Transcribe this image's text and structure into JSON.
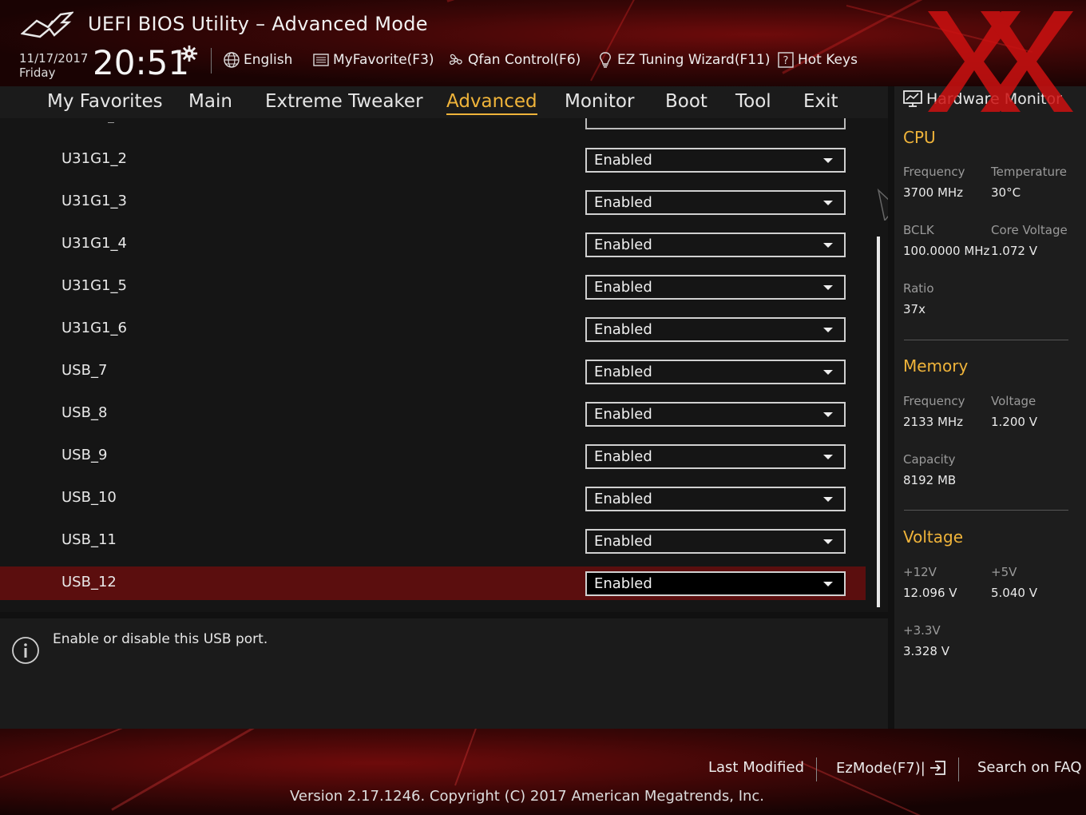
{
  "header": {
    "title": "UEFI BIOS Utility – Advanced Mode",
    "date": "11/17/2017",
    "day": "Friday",
    "time": "20:51",
    "tools": {
      "language": "English",
      "my_favorite": "MyFavorite(F3)",
      "qfan": "Qfan Control(F6)",
      "ez_tuning": "EZ Tuning Wizard(F11)",
      "hot_keys": "Hot Keys"
    }
  },
  "nav": {
    "items": [
      "My Favorites",
      "Main",
      "Extreme Tweaker",
      "Advanced",
      "Monitor",
      "Boot",
      "Tool",
      "Exit"
    ],
    "active": "Advanced"
  },
  "settings": [
    {
      "label": "U31G1_2",
      "value": "Enabled"
    },
    {
      "label": "U31G1_3",
      "value": "Enabled"
    },
    {
      "label": "U31G1_4",
      "value": "Enabled"
    },
    {
      "label": "U31G1_5",
      "value": "Enabled"
    },
    {
      "label": "U31G1_6",
      "value": "Enabled"
    },
    {
      "label": "USB_7",
      "value": "Enabled"
    },
    {
      "label": "USB_8",
      "value": "Enabled"
    },
    {
      "label": "USB_9",
      "value": "Enabled"
    },
    {
      "label": "USB_10",
      "value": "Enabled"
    },
    {
      "label": "USB_11",
      "value": "Enabled"
    },
    {
      "label": "USB_12",
      "value": "Enabled"
    }
  ],
  "selected_setting": "USB_12",
  "help": {
    "text": "Enable or disable this USB port."
  },
  "hardware_monitor": {
    "title": "Hardware Monitor",
    "cpu": {
      "heading": "CPU",
      "frequency_label": "Frequency",
      "frequency": "3700 MHz",
      "temperature_label": "Temperature",
      "temperature": "30°C",
      "bclk_label": "BCLK",
      "bclk": "100.0000 MHz",
      "core_voltage_label": "Core Voltage",
      "core_voltage": "1.072 V",
      "ratio_label": "Ratio",
      "ratio": "37x"
    },
    "memory": {
      "heading": "Memory",
      "frequency_label": "Frequency",
      "frequency": "2133 MHz",
      "voltage_label": "Voltage",
      "voltage": "1.200 V",
      "capacity_label": "Capacity",
      "capacity": "8192 MB"
    },
    "voltage": {
      "heading": "Voltage",
      "v12_label": "+12V",
      "v12": "12.096 V",
      "v5_label": "+5V",
      "v5": "5.040 V",
      "v33_label": "+3.3V",
      "v33": "3.328 V"
    }
  },
  "footer": {
    "last_modified": "Last Modified",
    "ez_mode": "EzMode(F7)|",
    "search_faq": "Search on FAQ",
    "version": "Version 2.17.1246. Copyright (C) 2017 American Megatrends, Inc."
  },
  "colors": {
    "accent": "#f0b43a",
    "selected_row": "#5b0e0e",
    "header_red": "#6e0b0b",
    "watermark": "#cc1111"
  }
}
